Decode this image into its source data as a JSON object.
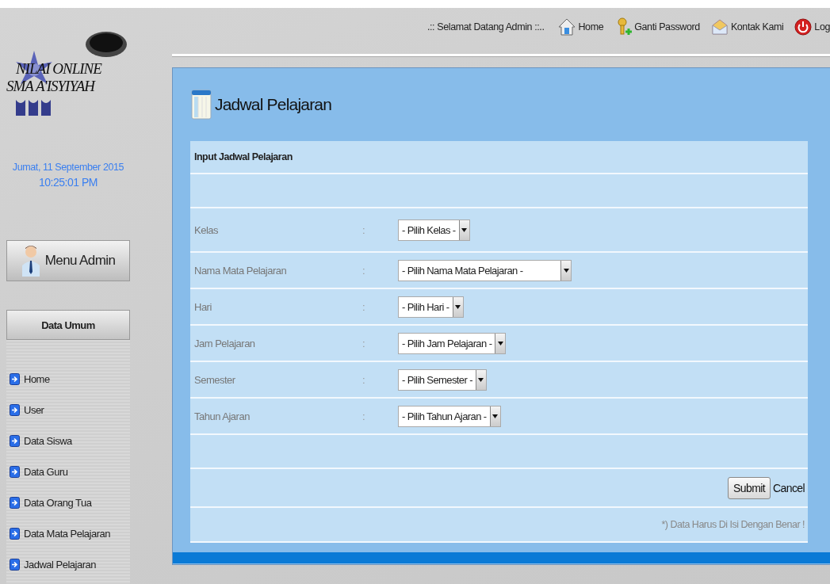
{
  "top_bar": {
    "greeting": ".:: Selamat Datang Admin ::..",
    "links": [
      {
        "label": "Home"
      },
      {
        "label": "Ganti Password"
      },
      {
        "label": "Kontak Kami"
      },
      {
        "label": "Log"
      }
    ]
  },
  "sidebar": {
    "logo": {
      "line_1": "NILAI ONLINE",
      "line_2": "SMA A'ISYIYAH"
    },
    "date": "Jumat, 11 September 2015",
    "time": "10:25:01 PM",
    "menu_button": "Menu Admin",
    "section_title": "Data Umum",
    "items": [
      {
        "label": "Home"
      },
      {
        "label": "User"
      },
      {
        "label": "Data Siswa"
      },
      {
        "label": "Data Guru"
      },
      {
        "label": "Data Orang Tua"
      },
      {
        "label": "Data Mata Pelajaran"
      },
      {
        "label": "Jadwal Pelajaran"
      }
    ]
  },
  "page": {
    "title": "Jadwal Pelajaran",
    "form": {
      "heading": "Input Jadwal Pelajaran",
      "fields": [
        {
          "label": "Kelas",
          "separator": ":",
          "value": "- Pilih Kelas -"
        },
        {
          "label": "Nama Mata Pelajaran",
          "separator": ":",
          "value": "- Pilih Nama Mata Pelajaran -",
          "wide": true
        },
        {
          "label": "Hari",
          "separator": ":",
          "value": "- Pilih Hari -"
        },
        {
          "label": "Jam Pelajaran",
          "separator": ":",
          "value": "- Pilih Jam Pelajaran -"
        },
        {
          "label": "Semester",
          "separator": ":",
          "value": "- Pilih Semester -"
        },
        {
          "label": "Tahun Ajaran",
          "separator": ":",
          "value": "- Pilih Tahun Ajaran -"
        }
      ],
      "submit": "Submit",
      "cancel": "Cancel",
      "note": "*) Data Harus Di Isi Dengan Benar !"
    }
  }
}
